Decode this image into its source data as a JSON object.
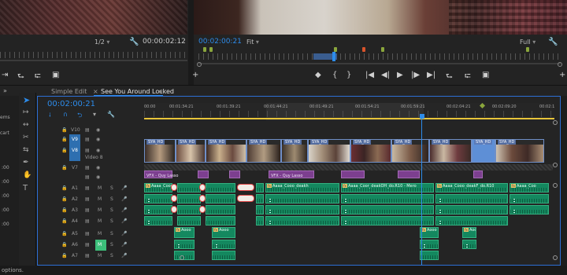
{
  "source_monitor": {
    "resolution": "1/2",
    "timecode": "00:00:02:12",
    "controls": [
      "{",
      "}",
      "|◀",
      "◀",
      "▶",
      "▶",
      "▶|",
      "⇆",
      "⇄",
      "▣",
      "+"
    ]
  },
  "program_monitor": {
    "timecode": "00:02:00:21",
    "zoom": "Fit",
    "resolution": "Full",
    "controls": [
      "◆",
      "{",
      "}",
      "|◀",
      "◀|",
      "▶",
      "|▶",
      "▶|",
      "⇥",
      "⇤",
      "▣",
      "+"
    ],
    "marker_colors": [
      "#8aa63c",
      "#8aa63c",
      "#d9532b",
      "#8aa63c",
      "#8aa63c"
    ]
  },
  "tabs": {
    "simple_edit": "Simple Edit",
    "active": "See You Around Locked",
    "close": "×",
    "menu": "≡"
  },
  "left_panel": {
    "chevron": "»",
    "fragments": [
      "ems",
      "cart",
      ":00",
      ":00",
      ":00",
      ":00",
      ":00"
    ]
  },
  "timeline": {
    "timecode": "00:02:00:21",
    "ruler_labels": [
      "00:00",
      "00:01:34:21",
      "00:01:39:21",
      "00:01:44:21",
      "00:01:49:21",
      "00:01:54:21",
      "00:01:59:21",
      "00:02:04:21",
      "00:02:09:20",
      "00:02:1"
    ],
    "video_tracks": [
      {
        "name": "V10",
        "label": ""
      },
      {
        "name": "V9",
        "label": ""
      },
      {
        "name": "V8",
        "label": "Video 8"
      },
      {
        "name": "V7",
        "label": ""
      }
    ],
    "audio_tracks": [
      "A1",
      "A2",
      "A3",
      "A4",
      "A5",
      "A6",
      "A7"
    ],
    "mute": "M",
    "solo": "S",
    "video_clip_label": "SYA_HD",
    "purple_clip_label": "VFX - Quy Lasso",
    "audio_clip_labels": {
      "c1": "Aaaa_Cooo_deakh",
      "c2": "Aaaa_Coor_deakOH_do.R10 - Mero",
      "c3": "Aaaa_Cooo_deakF_do.R10",
      "c4": "Aaaa_Coo",
      "c5": "Aooo",
      "c6": "Aooo",
      "c7": "Aooo",
      "c8": "Aooo"
    }
  },
  "status": {
    "text": "options."
  },
  "colors": {
    "accent_blue": "#2d8ceb",
    "playhead": "#2d8ceb",
    "audio_clip": "#14885f",
    "video_clip_border": "#6f8fc7",
    "fx_clip": "#7c3f8f",
    "work_area": "#e7c43a"
  }
}
